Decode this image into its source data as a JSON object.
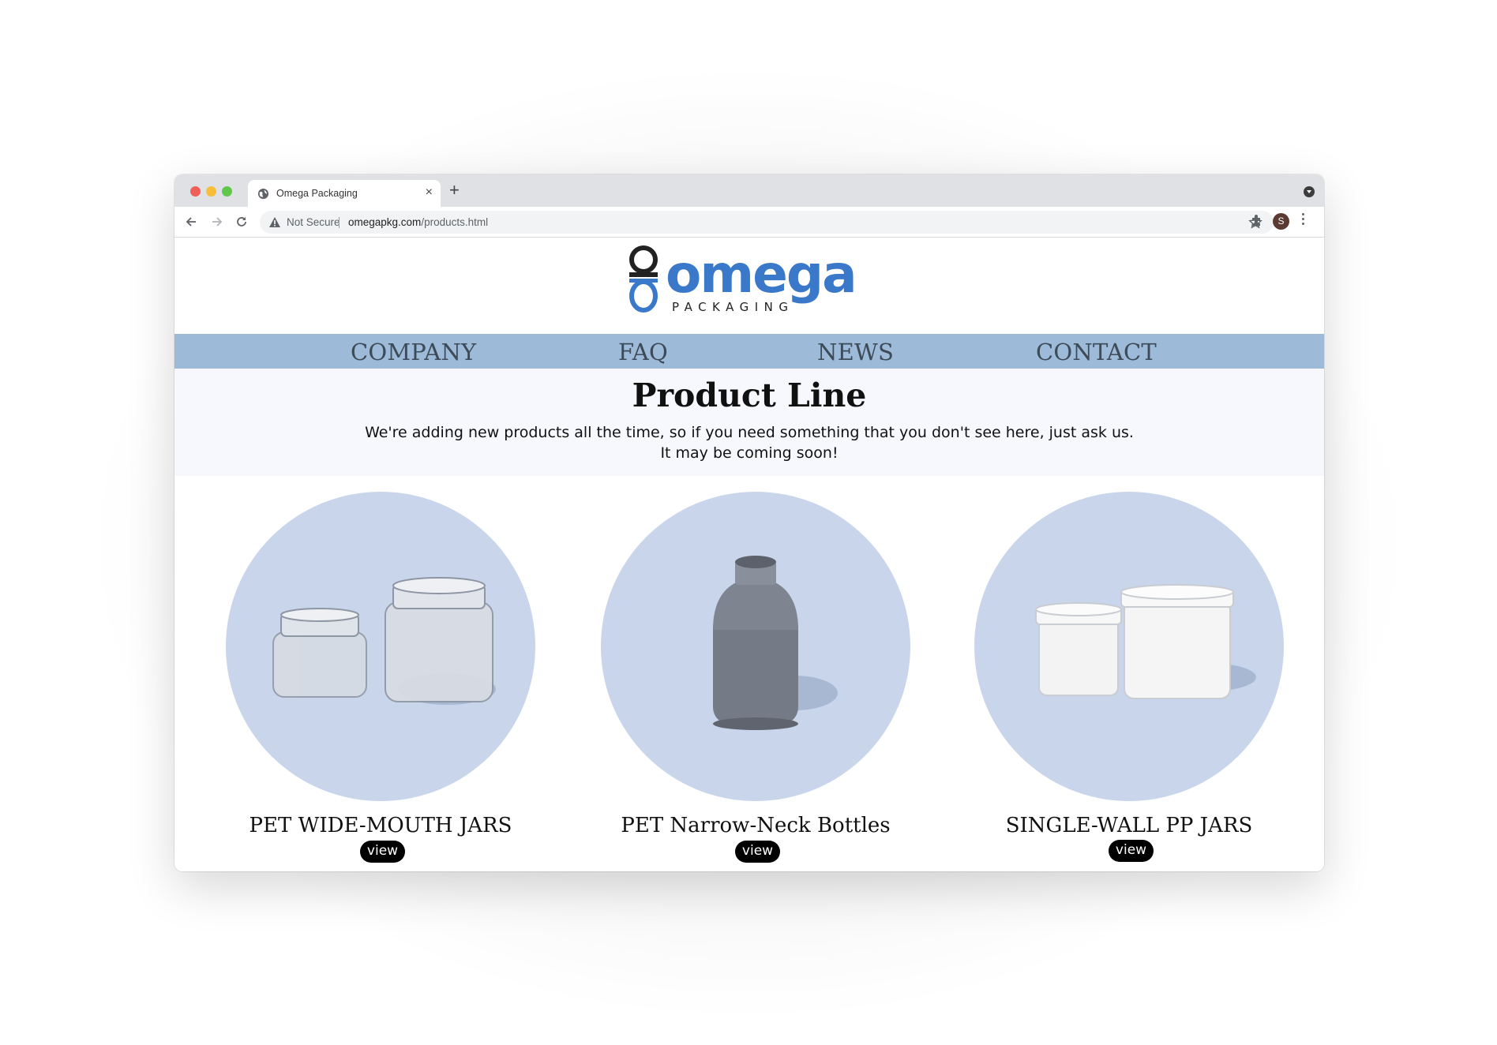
{
  "browser": {
    "tab_title": "Omega Packaging",
    "tab_close": "×",
    "new_tab": "+",
    "security_label": "Not Secure",
    "url_domain": "omegapkg.com",
    "url_path": "/products.html",
    "avatar_letter": "S",
    "icons": [
      "globe-icon",
      "back-icon",
      "forward-icon",
      "reload-icon",
      "warning-icon",
      "star-icon",
      "extensions-icon",
      "menu-icon",
      "tab-search-icon"
    ]
  },
  "logo": {
    "word": "omega",
    "tagline": "PACKAGING",
    "colors": {
      "brand_blue": "#3a78c9",
      "dark": "#222222"
    }
  },
  "nav": {
    "items": [
      "COMPANY",
      "FAQ",
      "NEWS",
      "CONTACT"
    ],
    "background": "#9dbad9"
  },
  "hero": {
    "title": "Product Line",
    "line1": "We're adding new products all the time, so if you need something that you don't see here, just ask us.",
    "line2": "It may be coming soon!"
  },
  "products": [
    {
      "name": "PET WIDE-MOUTH JARS",
      "button": "view"
    },
    {
      "name": "PET Narrow-Neck Bottles",
      "button": "view"
    },
    {
      "name": "SINGLE-WALL PP JARS",
      "button": "view"
    }
  ]
}
